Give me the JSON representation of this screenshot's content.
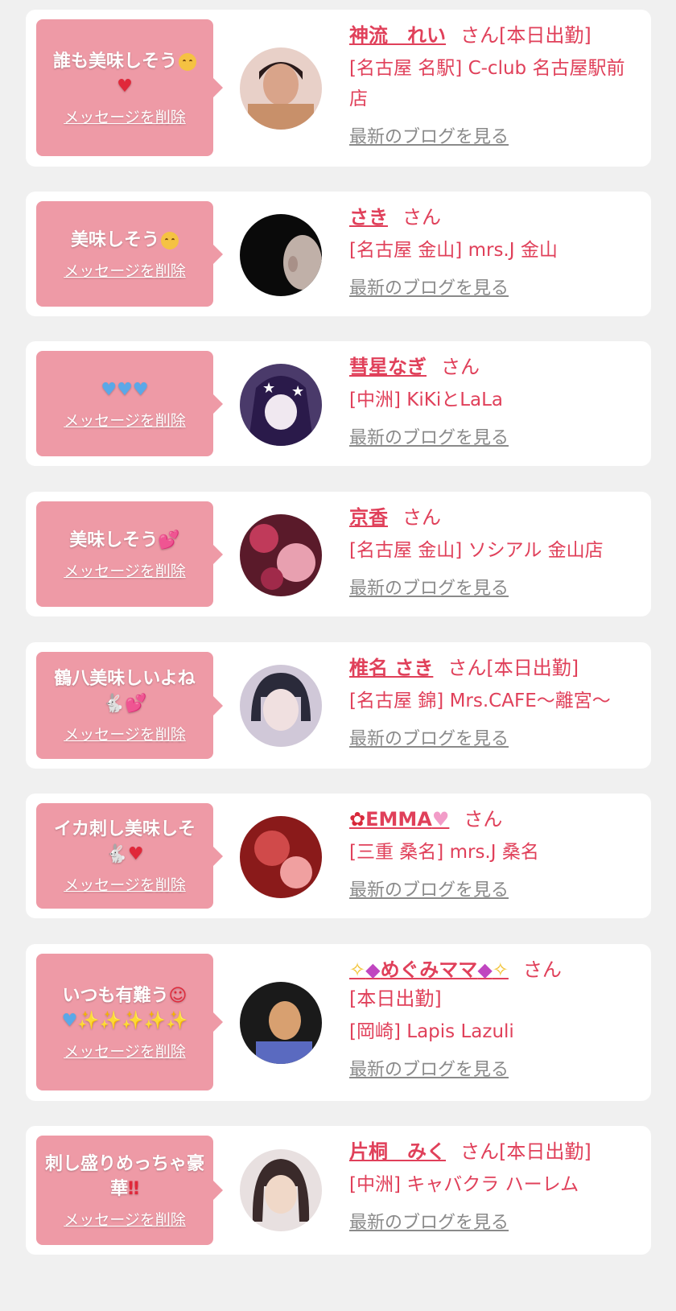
{
  "delete_label": "メッセージを削除",
  "blog_label": "最新のブログを見る",
  "honorific": "さん",
  "cards": [
    {
      "message": "誰も美味しそう",
      "message_icons": [
        "drooling-face-icon",
        "red-heart-icon"
      ],
      "name": "神流　れい",
      "status": "[本日出勤]",
      "area": "[名古屋 名駅]",
      "shop": "C-club 名古屋駅前店",
      "avatar_colors": [
        "#3a2a2a",
        "#d9a48a",
        "#f0d0c0"
      ]
    },
    {
      "message": "美味しそう",
      "message_icons": [
        "drooling-face-icon"
      ],
      "name": "さき",
      "status": "",
      "area": "[名古屋 金山]",
      "shop": "mrs.J 金山",
      "avatar_colors": [
        "#0a0a0a",
        "#1a1a1a",
        "#c0b0a8"
      ]
    },
    {
      "message": "",
      "message_icons": [
        "blue-heart-icon",
        "blue-heart-icon",
        "blue-heart-icon"
      ],
      "name": "彗星なぎ",
      "status": "",
      "area": "[中洲]",
      "shop": "KiKiとLaLa",
      "avatar_colors": [
        "#3a2a5a",
        "#7a5aa0",
        "#ffffff"
      ]
    },
    {
      "message": "美味しそう",
      "message_icons": [
        "hearts-icon"
      ],
      "name": "京香",
      "status": "",
      "area": "[名古屋 金山]",
      "shop": "ソシアル 金山店",
      "avatar_colors": [
        "#5a1a2a",
        "#c03a5a",
        "#e8a0b0"
      ]
    },
    {
      "message": "鶴八美味しいよね",
      "message_icons": [
        "rabbit-icon",
        "hearts-icon"
      ],
      "name": "椎名 さき",
      "status": "[本日出勤]",
      "area": "[名古屋 錦]",
      "shop": "Mrs.CAFE〜離宮〜",
      "avatar_colors": [
        "#2a2a3a",
        "#f0e0e0",
        "#d0c8d8"
      ]
    },
    {
      "message": "イカ刺し美味しそ",
      "message_icons": [
        "rabbit-icon",
        "red-heart-icon"
      ],
      "name": "EMMA",
      "name_prefix_icon": "rose-icon",
      "name_suffix_icon": "pink-heart-icon",
      "status": "",
      "area": "[三重 桑名]",
      "shop": "mrs.J 桑名",
      "avatar_colors": [
        "#8a1a1a",
        "#d04a4a",
        "#f0a0a0"
      ]
    },
    {
      "message": "いつも有難う",
      "message_icons": [
        "smiling-hearts-icon",
        "blue-heart-icon",
        "sparkles-icon",
        "sparkles-icon",
        "sparkles-icon",
        "sparkles-icon",
        "sparkles-icon"
      ],
      "name": "めぐみママ",
      "name_prefix_icon": "sparkles-gem-icon",
      "name_suffix_icon": "gem-sparkles-icon",
      "status": "[本日出勤]",
      "area": "[岡崎]",
      "shop": "Lapis Lazuli",
      "avatar_colors": [
        "#1a1a1a",
        "#d8a070",
        "#5a6ac0"
      ]
    },
    {
      "message": "刺し盛りめっちゃ豪華",
      "message_icons": [
        "double-exclamation-icon"
      ],
      "name": "片桐　みく",
      "status": "[本日出勤]",
      "area": "[中洲]",
      "shop": "キャバクラ ハーレム",
      "avatar_colors": [
        "#3a2a2a",
        "#f0d8c8",
        "#e8e0e0"
      ]
    }
  ]
}
